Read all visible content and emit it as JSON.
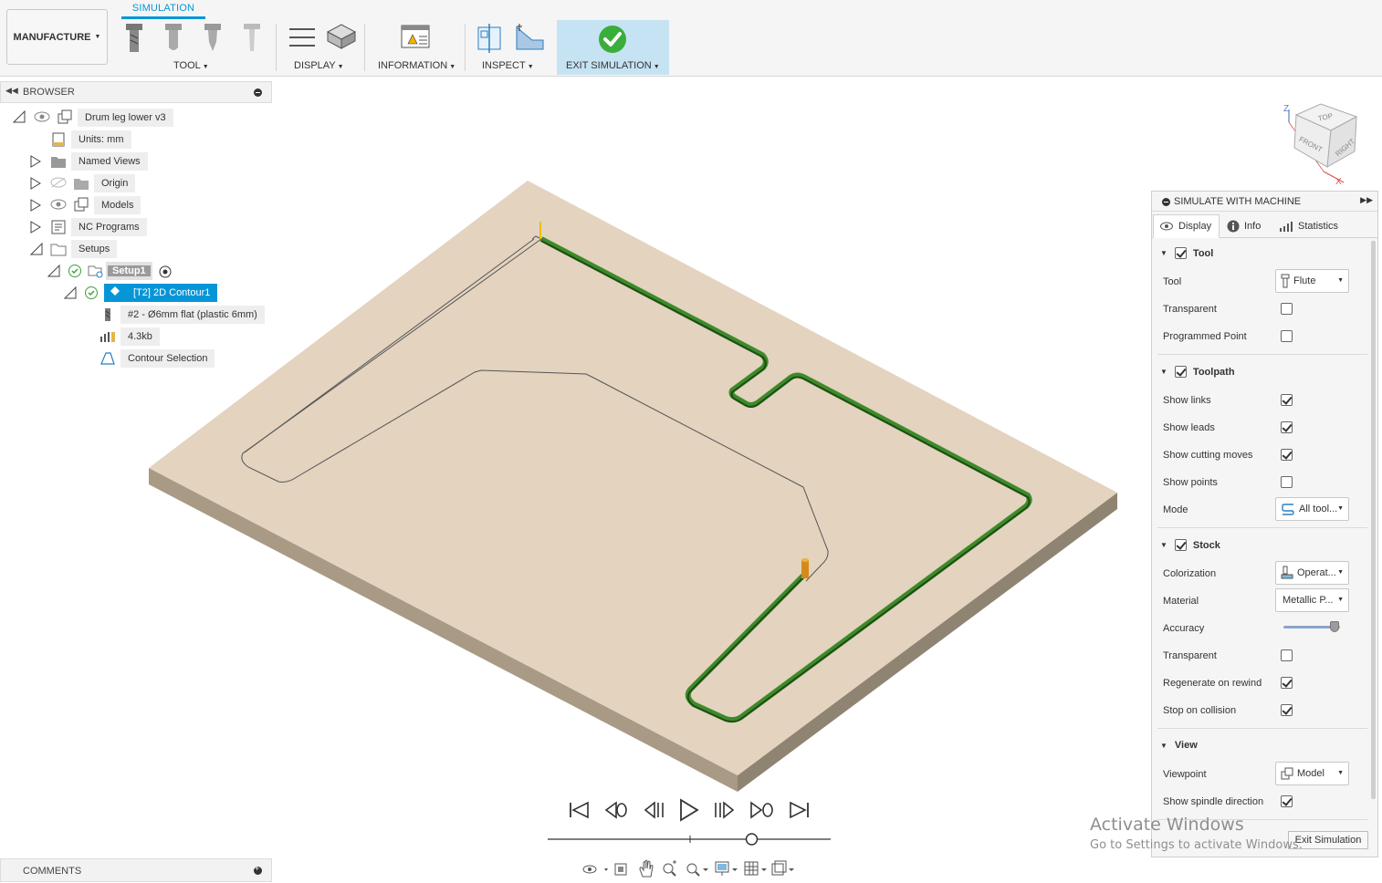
{
  "toolbar": {
    "workspace": "MANUFACTURE",
    "tab": "SIMULATION",
    "groups": {
      "tool": "TOOL",
      "display": "DISPLAY",
      "information": "INFORMATION",
      "inspect": "INSPECT",
      "exit_simulation": "EXIT SIMULATION"
    }
  },
  "browser": {
    "title": "BROWSER",
    "items": {
      "root": "Drum leg lower v3",
      "units": "Units: mm",
      "named_views": "Named Views",
      "origin": "Origin",
      "models": "Models",
      "nc_programs": "NC Programs",
      "setups": "Setups",
      "setup1": "Setup1",
      "operation": "[T2] 2D Contour1",
      "tool": "#2 - Ø6mm flat (plastic 6mm)",
      "size": "4.3kb",
      "contour_selection": "Contour Selection"
    }
  },
  "comments": {
    "title": "COMMENTS"
  },
  "viewcube": {
    "top": "TOP",
    "front": "FRONT",
    "right": "RIGHT",
    "axis_z": "Z",
    "axis_x": "X"
  },
  "sim_panel": {
    "title": "SIMULATE WITH MACHINE",
    "tabs": {
      "display": "Display",
      "info": "Info",
      "statistics": "Statistics"
    },
    "tool_section": {
      "header": "Tool",
      "tool_label": "Tool",
      "tool_value": "Flute",
      "transparent_label": "Transparent",
      "programmed_point_label": "Programmed Point"
    },
    "toolpath_section": {
      "header": "Toolpath",
      "show_links": "Show links",
      "show_leads": "Show leads",
      "show_cutting_moves": "Show cutting moves",
      "show_points": "Show points",
      "mode_label": "Mode",
      "mode_value": "All tool..."
    },
    "stock_section": {
      "header": "Stock",
      "colorization_label": "Colorization",
      "colorization_value": "Operat...",
      "material_label": "Material",
      "material_value": "Metallic P...",
      "accuracy_label": "Accuracy",
      "accuracy_level": 0.9,
      "transparent_label": "Transparent",
      "regenerate_label": "Regenerate on rewind",
      "stop_on_collision_label": "Stop on collision"
    },
    "view_section": {
      "header": "View",
      "viewpoint_label": "Viewpoint",
      "viewpoint_value": "Model",
      "spindle_label": "Show spindle direction"
    },
    "exit_button": "Exit Simulation"
  },
  "watermark": {
    "title": "Activate Windows",
    "subtitle": "Go to Settings to activate Windows."
  },
  "playback": {
    "progress": 0.73
  },
  "colors": {
    "accent": "#0696d7",
    "stock": "#e3d3c0",
    "toolpath": "#2f6b1f",
    "check": "#3aa23a"
  }
}
